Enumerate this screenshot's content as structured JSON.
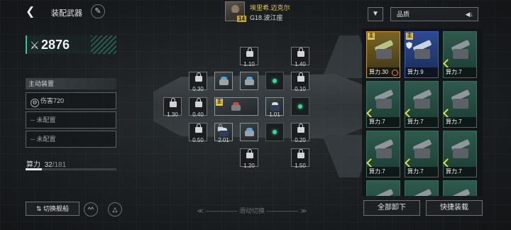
{
  "header": {
    "title": "装配武器",
    "captain": {
      "name": "埃里希.迈克尔",
      "level": "14",
      "ship": "G18.波江座"
    }
  },
  "power": {
    "value": "2876"
  },
  "active_equipment": {
    "title": "主动装置",
    "slots": [
      {
        "label": "伤害720",
        "type": "equipped"
      },
      {
        "label": "-- 未配置",
        "type": "empty"
      },
      {
        "label": "-- 未配置",
        "type": "empty"
      }
    ]
  },
  "computing_power": {
    "label": "算力",
    "used": "32",
    "total": "/181",
    "fraction": 0.177
  },
  "buttons": {
    "switch_ship": "切换舰船",
    "swipe_hint": "滑动切换",
    "unload_all": "全部卸下",
    "quick_equip": "快捷装载"
  },
  "filter": {
    "sort_label": "品质"
  },
  "ship_slots": {
    "top_row": [
      {
        "value": "1.10"
      },
      {
        "value": "1.40"
      }
    ],
    "row2": [
      {
        "value": "0.30"
      },
      {
        "value": ""
      },
      {
        "value": ""
      },
      {
        "value": ""
      },
      {
        "value": "0.10"
      }
    ],
    "row3": [
      {
        "value": "1.30"
      },
      {
        "value": "0.40"
      },
      {
        "value": ""
      },
      {
        "value": "1.01"
      },
      {
        "value": ""
      }
    ],
    "row4": [
      {
        "value": "0.50"
      },
      {
        "value": "2.01"
      },
      {
        "value": ""
      },
      {
        "value": ""
      },
      {
        "value": "0.20"
      }
    ],
    "bottom_row": [
      {
        "value": "1.20"
      },
      {
        "value": "1.50"
      }
    ]
  },
  "inventory": [
    {
      "cp": "算力.30",
      "rarity": "gold",
      "main_tag": "主"
    },
    {
      "cp": "算力.9",
      "rarity": "blue",
      "main_tag": "主"
    },
    {
      "cp": "算力.7",
      "rarity": "green"
    },
    {
      "cp": "算力.7",
      "rarity": "green"
    },
    {
      "cp": "算力.7",
      "rarity": "green"
    },
    {
      "cp": "算力.7",
      "rarity": "green"
    },
    {
      "cp": "算力.7",
      "rarity": "green"
    },
    {
      "cp": "算力.7",
      "rarity": "green"
    },
    {
      "cp": "算力.7",
      "rarity": "green"
    }
  ],
  "main_tag_text": "主",
  "colors": {
    "accent": "#2cc69a",
    "gold": "#c79b2c",
    "blue": "#3b5fb8",
    "green": "#3a6e5d"
  }
}
